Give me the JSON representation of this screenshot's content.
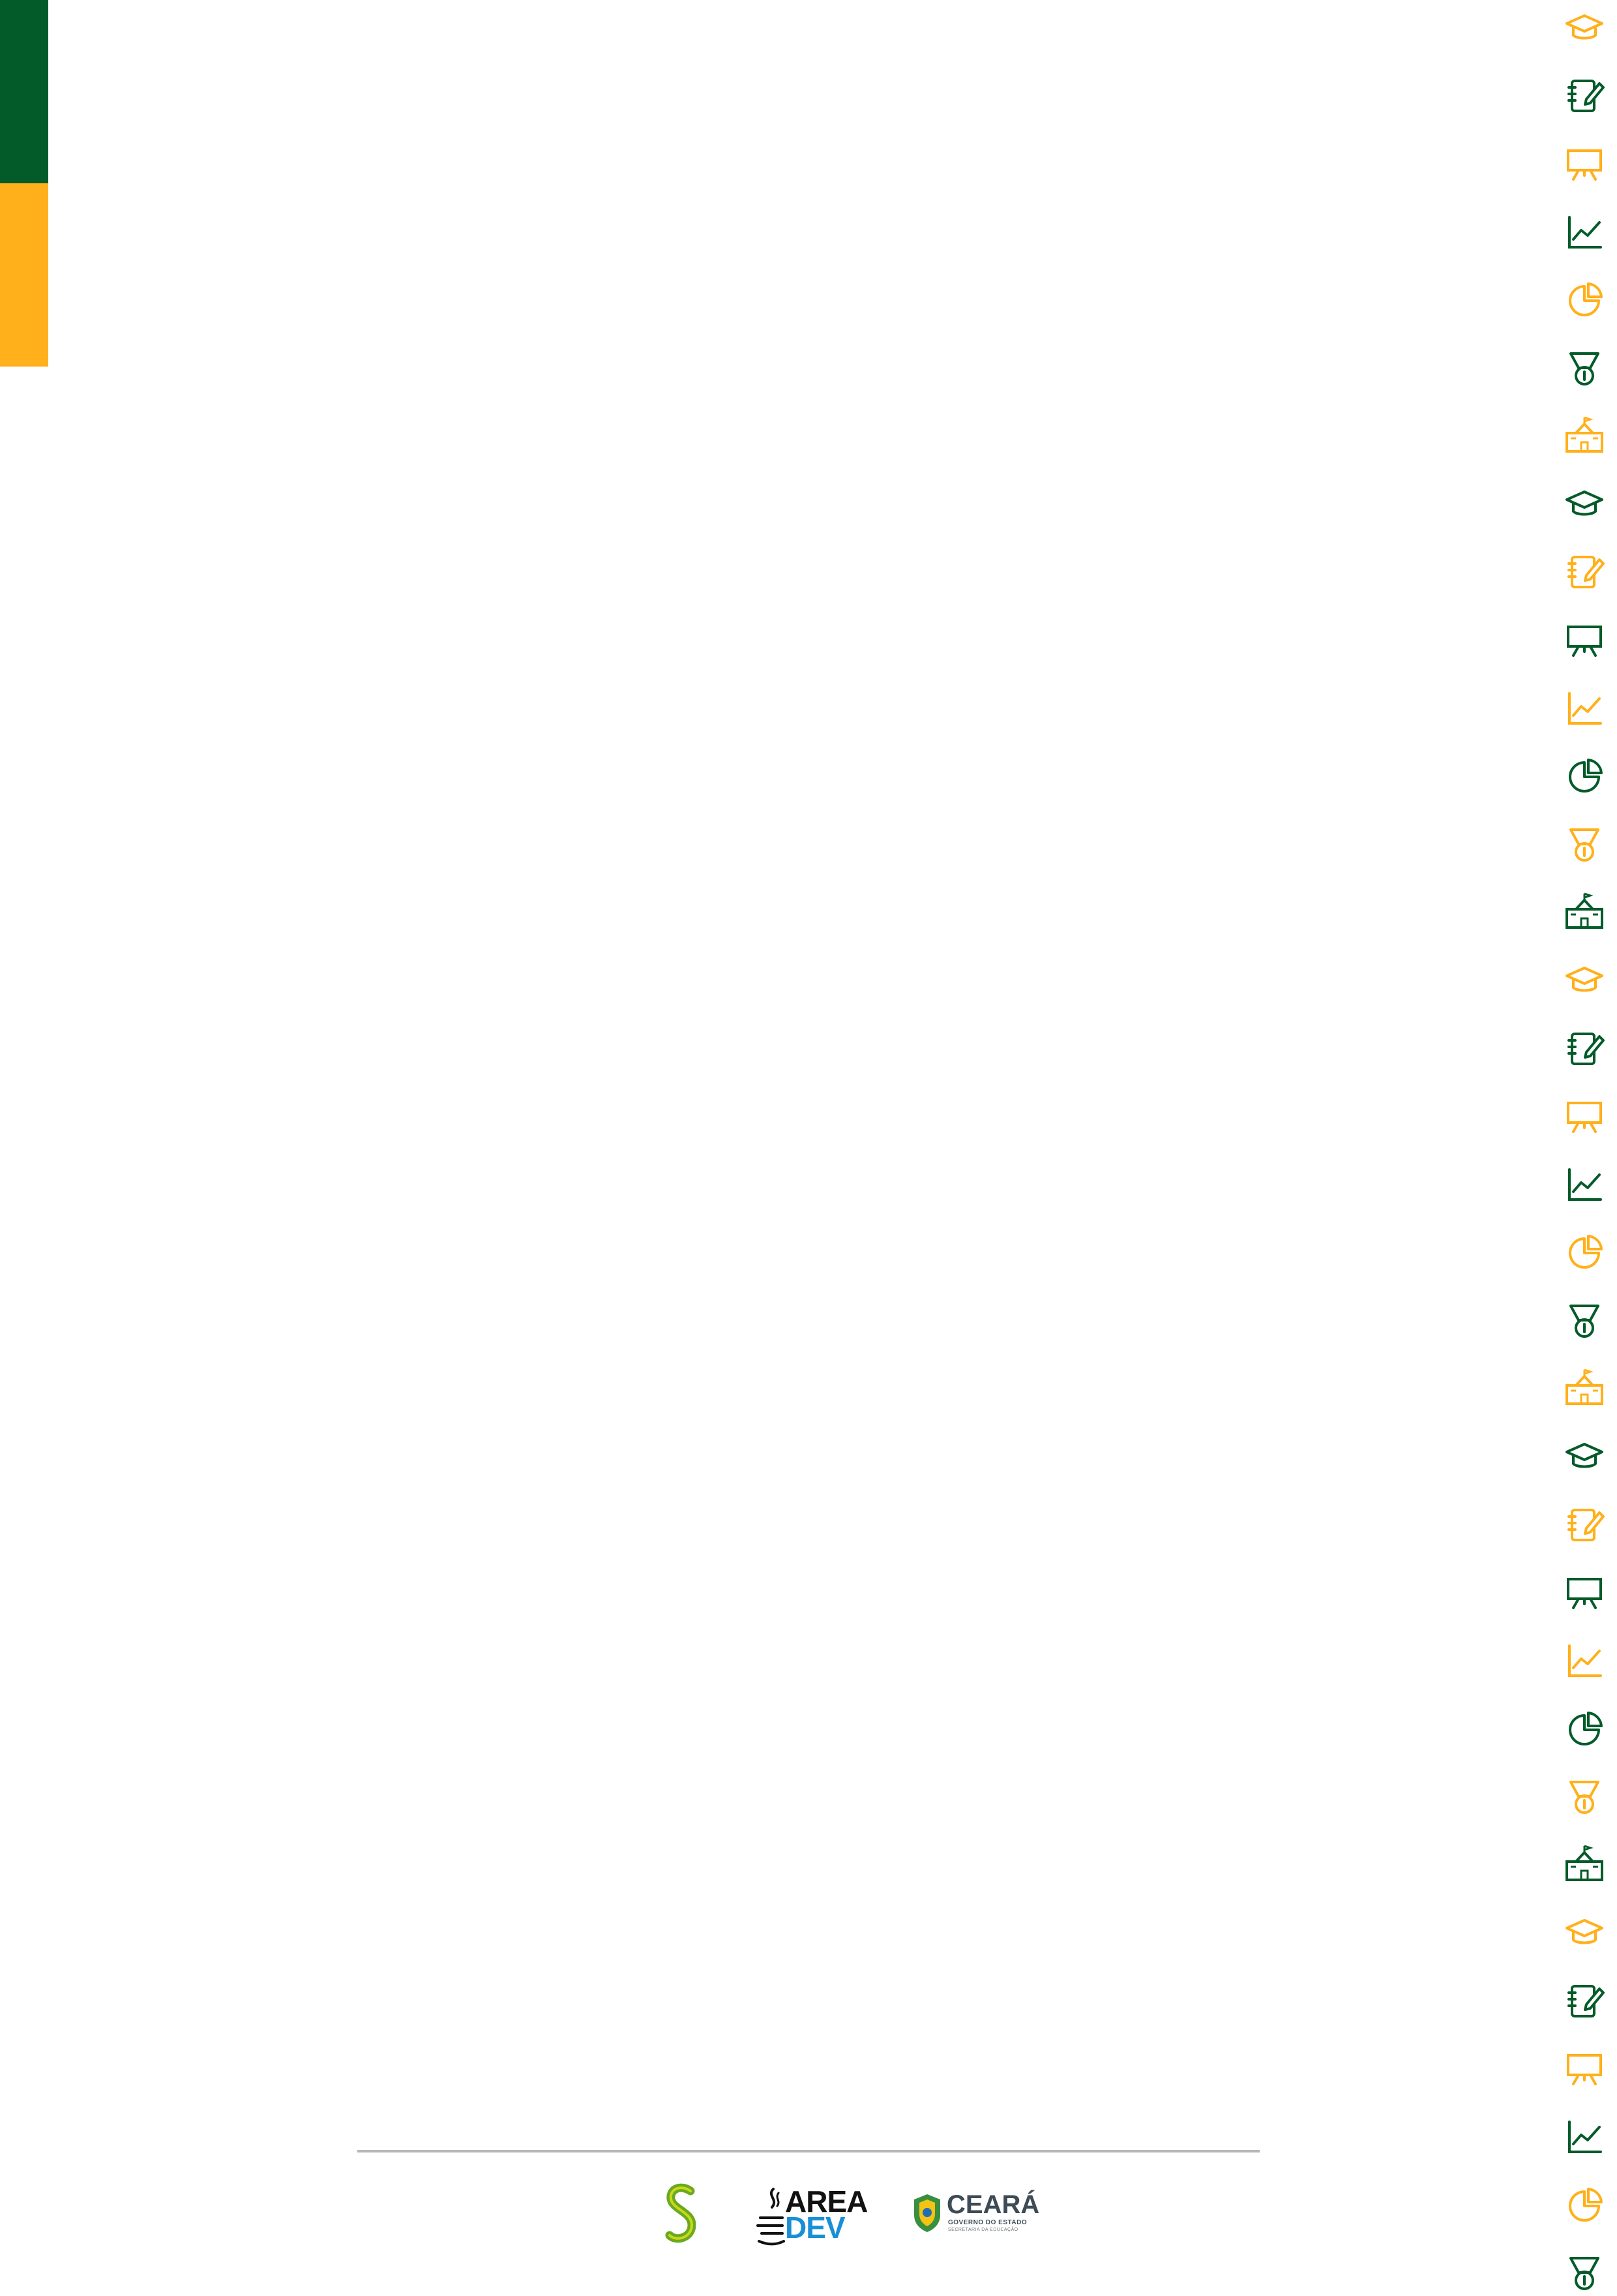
{
  "colors": {
    "green": "#045b2a",
    "yellow": "#ffb01a",
    "rule": "#b7b7b7",
    "blue": "#1a8fd6",
    "slate": "#3c4b55"
  },
  "icon_sequence": [
    "graduation-cap-icon",
    "notebook-pen-icon",
    "presentation-board-icon",
    "line-chart-icon",
    "pie-chart-icon",
    "medal-icon",
    "school-building-icon"
  ],
  "icon_colors": [
    "#ffb01a",
    "#045b2a"
  ],
  "footer": {
    "logos": [
      "s-logo",
      "area-dev-logo",
      "ceara-government-logo"
    ],
    "area_dev": {
      "line1": "AREA",
      "line2": "DEV"
    },
    "ceara": {
      "name": "CEARÁ",
      "line1": "GOVERNO DO ESTADO",
      "line2": "SECRETARIA DA EDUCAÇÃO"
    }
  }
}
